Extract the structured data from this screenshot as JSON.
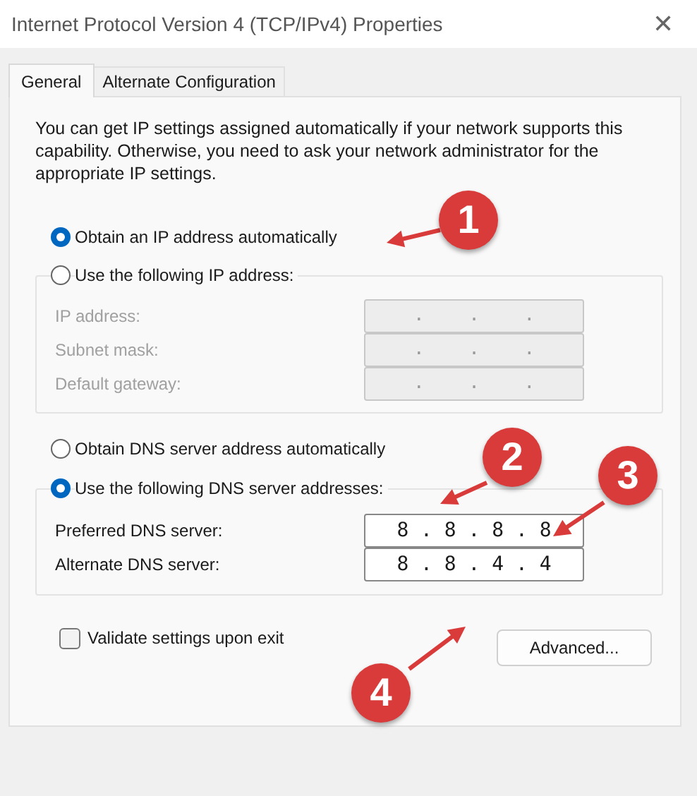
{
  "window": {
    "title": "Internet Protocol Version 4 (TCP/IPv4) Properties",
    "close": "✕"
  },
  "tabs": [
    {
      "label": "General",
      "selected": true
    },
    {
      "label": "Alternate Configuration",
      "selected": false
    }
  ],
  "description": "You can get IP settings assigned automatically if your network supports this capability. Otherwise, you need to ask your network administrator for the appropriate IP settings.",
  "ip_options": [
    {
      "label": "Obtain an IP address automatically",
      "selected": true
    },
    {
      "label": "Use the following IP address:",
      "selected": false
    }
  ],
  "ip_fields": [
    {
      "label": "IP address:",
      "value": "   .    .    .   ",
      "disabled": true
    },
    {
      "label": "Subnet mask:",
      "value": "   .    .    .   ",
      "disabled": true
    },
    {
      "label": "Default gateway:",
      "value": "   .    .    .   ",
      "disabled": true
    }
  ],
  "dns_options": [
    {
      "label": "Obtain DNS server address automatically",
      "selected": false
    },
    {
      "label": "Use the following DNS server addresses:",
      "selected": true
    }
  ],
  "dns_fields": [
    {
      "label": "Preferred DNS server:",
      "value": "8 . 8 . 8 . 8",
      "disabled": false
    },
    {
      "label": "Alternate DNS server:",
      "value": "8 . 8 . 4 . 4",
      "disabled": false
    }
  ],
  "validate": {
    "label": "Validate settings upon exit",
    "checked": false
  },
  "advanced_button": "Advanced...",
  "callouts": [
    {
      "number": "1"
    },
    {
      "number": "2"
    },
    {
      "number": "3"
    },
    {
      "number": "4"
    }
  ]
}
